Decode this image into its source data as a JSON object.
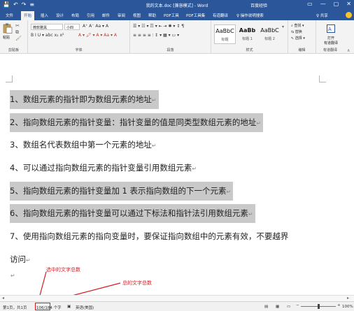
{
  "titlebar": {
    "quick_access": [
      "💾",
      "↶",
      "↷",
      "≡"
    ],
    "title": "我的文本.doc [兼容模式] - Word",
    "user": "百度经验",
    "win_buttons": [
      "▭",
      "—",
      "▢",
      "✕"
    ]
  },
  "tabs": {
    "items": [
      "文件",
      "开始",
      "插入",
      "设计",
      "布局",
      "引用",
      "邮件",
      "审阅",
      "视图",
      "帮助",
      "PDF工具",
      "PDF工具集",
      "有道翻译",
      "♀ 操作说明搜索"
    ],
    "active_index": 1,
    "share": "♀ 共享"
  },
  "ribbon": {
    "clipboard": {
      "paste_label": "粘贴",
      "label": "剪贴板"
    },
    "font": {
      "font_name": "微软雅黑",
      "font_size": "小四",
      "row1_tools": "A⁺ A⁻ Aa ▾ A",
      "row2_tools": "B  I  U ▾ abc x₂ x²",
      "row2b_tools": "A ▾ 🖍 ▾ A ▾ Aa ▾ A",
      "label": "字体"
    },
    "paragraph": {
      "row1_tools": "☰ ▾  ☷ ▾  ☶ ▾  ⇤ ⇥  ✱ ▾  ↕  ¶",
      "row2_tools": "≡  ≡  ≡  ≡  ⫶  ↕ ▾  ▦ ▾  ▭ ▾",
      "label": "段落"
    },
    "styles": {
      "samples": [
        {
          "sample": "AaBbC",
          "name": "标题"
        },
        {
          "sample": "AaBb",
          "name": "标题 1"
        },
        {
          "sample": "AaBbC",
          "name": "标题 2"
        }
      ],
      "label": "样式"
    },
    "editing": {
      "find": "查找 ▾",
      "replace": "替换",
      "select": "选择 ▾",
      "label": "编辑"
    },
    "translate": {
      "line1": "打开",
      "line2": "有道翻译",
      "label": "有道翻译"
    }
  },
  "document": {
    "lines": [
      {
        "text": "1、数组元素的指针即为数组元素的地址",
        "highlighted": true
      },
      {
        "text": "2、指向数组元素的指针变量：指针变量的值是同类型数组元素的地址",
        "highlighted": true
      },
      {
        "text": "3、数组名代表数组中第一个元素的地址",
        "highlighted": false
      },
      {
        "text": "4、可以通过指向数组元素的指针变量引用数组元素",
        "highlighted": false
      },
      {
        "text": "5、指向数组元素的指针变量加 1 表示指向数组的下一个元素",
        "highlighted": true
      },
      {
        "text": "6、指向数组元素的指针变量可以通过下标法和指针法引用数组元素",
        "highlighted": true
      },
      {
        "text": "7、使用指向数组元素的指向变量时，要保证指向数组中的元素有效，不要越界",
        "highlighted": false
      },
      {
        "text": "访问",
        "highlighted": false
      }
    ],
    "para_mark": "↵"
  },
  "annotations": {
    "selected_count": "选中的文字总数",
    "total_count": "总的文字总数",
    "color": "#d7191f"
  },
  "statusbar": {
    "page": "第1页，共1页",
    "words": "106/184 个字",
    "lang": "英语(美国)",
    "zoom": "100%"
  },
  "colors": {
    "ribbon_blue": "#2b579a",
    "highlight_gray": "#c9c9c9"
  }
}
